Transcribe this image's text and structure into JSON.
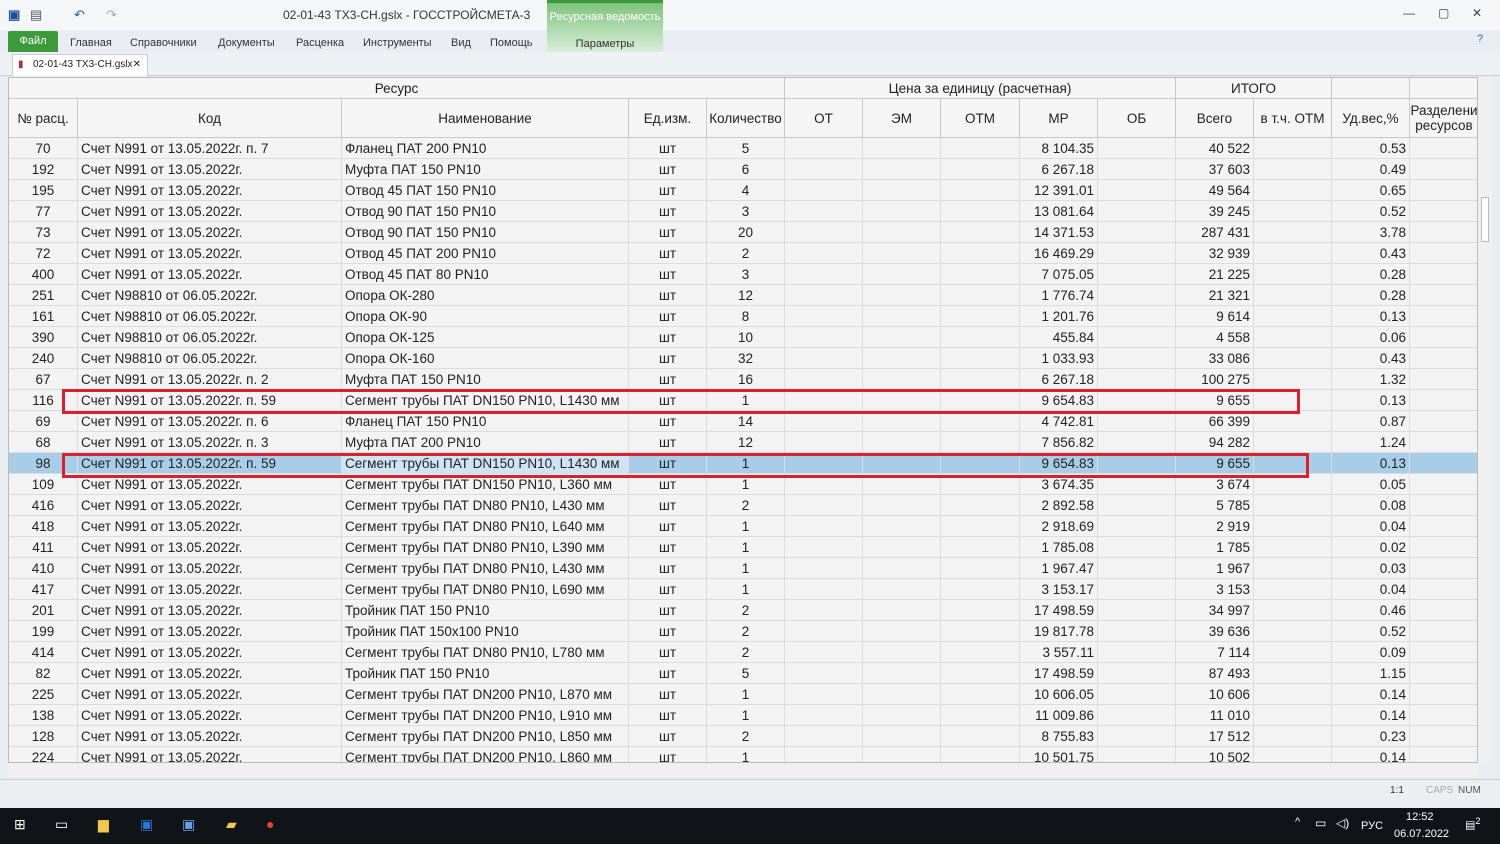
{
  "window": {
    "title": "02-01-43 ТХ3-СН.gslx - ГОССТРОЙСМЕТА-3",
    "context_tab": "Ресурсная ведомость",
    "context_sub": "Параметры"
  },
  "menu": [
    "Файл",
    "Главная",
    "Справочники",
    "Документы",
    "Расценка",
    "Инструменты",
    "Вид",
    "Помощь"
  ],
  "doc_tab": "02-01-43 ТХ3-СН.gslx",
  "header": {
    "group_resource": "Ресурс",
    "group_price": "Цена за единицу (расчетная)",
    "group_total": "ИТОГО",
    "cols": [
      "№ расц.",
      "Код",
      "Наименование",
      "Ед.изм.",
      "Количество",
      "ОТ",
      "ЭМ",
      "ОТМ",
      "МР",
      "ОБ",
      "Всего",
      "в т.ч. ОТМ",
      "Уд.вес,%",
      "Разделени ресурсов"
    ]
  },
  "rows": [
    [
      "70",
      "Счет N991 от 13.05.2022г. п. 7",
      "Фланец ПАТ 200 PN10",
      "шт",
      "5",
      "8 104.35",
      "40 522",
      "0.53"
    ],
    [
      "192",
      "Счет N991 от 13.05.2022г.",
      "Муфта ПАТ 150 PN10",
      "шт",
      "6",
      "6 267.18",
      "37 603",
      "0.49"
    ],
    [
      "195",
      "Счет N991 от 13.05.2022г.",
      "Отвод 45 ПАТ 150 PN10",
      "шт",
      "4",
      "12 391.01",
      "49 564",
      "0.65"
    ],
    [
      "77",
      "Счет N991 от 13.05.2022г.",
      "Отвод 90 ПАТ 150 PN10",
      "шт",
      "3",
      "13 081.64",
      "39 245",
      "0.52"
    ],
    [
      "73",
      "Счет N991 от 13.05.2022г.",
      "Отвод 90 ПАТ 150 PN10",
      "шт",
      "20",
      "14 371.53",
      "287 431",
      "3.78"
    ],
    [
      "72",
      "Счет N991 от 13.05.2022г.",
      "Отвод 45 ПАТ 200 PN10",
      "шт",
      "2",
      "16 469.29",
      "32 939",
      "0.43"
    ],
    [
      "400",
      "Счет N991 от 13.05.2022г.",
      "Отвод 45 ПАТ 80 PN10",
      "шт",
      "3",
      "7 075.05",
      "21 225",
      "0.28"
    ],
    [
      "251",
      "Счет N98810 от 06.05.2022г.",
      "Опора ОК-280",
      "шт",
      "12",
      "1 776.74",
      "21 321",
      "0.28"
    ],
    [
      "161",
      "Счет N98810 от 06.05.2022г.",
      "Опора ОК-90",
      "шт",
      "8",
      "1 201.76",
      "9 614",
      "0.13"
    ],
    [
      "390",
      "Счет N98810 от 06.05.2022г.",
      "Опора ОК-125",
      "шт",
      "10",
      "455.84",
      "4 558",
      "0.06"
    ],
    [
      "240",
      "Счет N98810 от 06.05.2022г.",
      "Опора ОК-160",
      "шт",
      "32",
      "1 033.93",
      "33 086",
      "0.43"
    ],
    [
      "67",
      "Счет N991 от 13.05.2022г. п. 2",
      "Муфта ПАТ 150 PN10",
      "шт",
      "16",
      "6 267.18",
      "100 275",
      "1.32"
    ],
    [
      "116",
      "Счет N991 от 13.05.2022г. п. 59",
      "Сегмент трубы ПАТ DN150 PN10, L1430 мм",
      "шт",
      "1",
      "9 654.83",
      "9 655",
      "0.13"
    ],
    [
      "69",
      "Счет N991 от 13.05.2022г. п. 6",
      "Фланец ПАТ 150 PN10",
      "шт",
      "14",
      "4 742.81",
      "66 399",
      "0.87"
    ],
    [
      "68",
      "Счет N991 от 13.05.2022г. п. 3",
      "Муфта ПАТ 200 PN10",
      "шт",
      "12",
      "7 856.82",
      "94 282",
      "1.24"
    ],
    [
      "98",
      "Счет N991 от 13.05.2022г. п. 59",
      "Сегмент трубы ПАТ DN150 PN10, L1430 мм",
      "шт",
      "1",
      "9 654.83",
      "9 655",
      "0.13"
    ],
    [
      "109",
      "Счет N991 от 13.05.2022г.",
      "Сегмент трубы ПАТ DN150 PN10, L360 мм",
      "шт",
      "1",
      "3 674.35",
      "3 674",
      "0.05"
    ],
    [
      "416",
      "Счет N991 от 13.05.2022г.",
      "Сегмент трубы ПАТ DN80 PN10, L430 мм",
      "шт",
      "2",
      "2 892.58",
      "5 785",
      "0.08"
    ],
    [
      "418",
      "Счет N991 от 13.05.2022г.",
      "Сегмент трубы ПАТ DN80 PN10, L640 мм",
      "шт",
      "1",
      "2 918.69",
      "2 919",
      "0.04"
    ],
    [
      "411",
      "Счет N991 от 13.05.2022г.",
      "Сегмент трубы ПАТ DN80 PN10, L390 мм",
      "шт",
      "1",
      "1 785.08",
      "1 785",
      "0.02"
    ],
    [
      "410",
      "Счет N991 от 13.05.2022г.",
      "Сегмент трубы ПАТ DN80 PN10, L430 мм",
      "шт",
      "1",
      "1 967.47",
      "1 967",
      "0.03"
    ],
    [
      "417",
      "Счет N991 от 13.05.2022г.",
      "Сегмент трубы ПАТ DN80 PN10, L690 мм",
      "шт",
      "1",
      "3 153.17",
      "3 153",
      "0.04"
    ],
    [
      "201",
      "Счет N991 от 13.05.2022г.",
      "Тройник ПАТ 150 PN10",
      "шт",
      "2",
      "17 498.59",
      "34 997",
      "0.46"
    ],
    [
      "199",
      "Счет N991 от 13.05.2022г.",
      "Тройник ПАТ 150х100 PN10",
      "шт",
      "2",
      "19 817.78",
      "39 636",
      "0.52"
    ],
    [
      "414",
      "Счет N991 от 13.05.2022г.",
      "Сегмент трубы ПАТ DN80 PN10, L780 мм",
      "шт",
      "2",
      "3 557.11",
      "7 114",
      "0.09"
    ],
    [
      "82",
      "Счет N991 от 13.05.2022г.",
      "Тройник ПАТ 150 PN10",
      "шт",
      "5",
      "17 498.59",
      "87 493",
      "1.15"
    ],
    [
      "225",
      "Счет N991 от 13.05.2022г.",
      "Сегмент трубы ПАТ DN200 PN10, L870 мм",
      "шт",
      "1",
      "10 606.05",
      "10 606",
      "0.14"
    ],
    [
      "138",
      "Счет N991 от 13.05.2022г.",
      "Сегмент трубы ПАТ DN200 PN10, L910 мм",
      "шт",
      "1",
      "11 009.86",
      "11 010",
      "0.14"
    ],
    [
      "128",
      "Счет N991 от 13.05.2022г.",
      "Сегмент трубы ПАТ DN200 PN10, L850 мм",
      "шт",
      "2",
      "8 755.83",
      "17 512",
      "0.23"
    ],
    [
      "224",
      "Счет N991 от 13.05.2022г.",
      "Сегмент трубы ПАТ DN200 PN10, L860 мм",
      "шт",
      "1",
      "10 501.75",
      "10 502",
      "0.14"
    ]
  ],
  "selected_row": 15,
  "highlighted_rows": [
    12,
    15
  ],
  "status": {
    "zoom": "1:1",
    "caps": "CAPS",
    "num": "NUM"
  },
  "taskbar": {
    "lang": "РУС",
    "time": "12:52",
    "date": "06.07.2022",
    "notifications": "2"
  }
}
